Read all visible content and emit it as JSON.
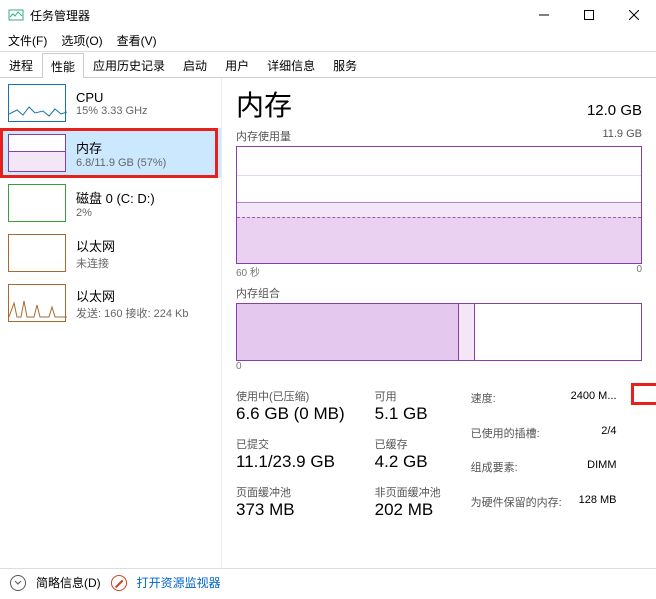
{
  "window": {
    "title": "任务管理器"
  },
  "menu": {
    "file": "文件(F)",
    "options": "选项(O)",
    "view": "查看(V)"
  },
  "tabs": [
    "进程",
    "性能",
    "应用历史记录",
    "启动",
    "用户",
    "详细信息",
    "服务"
  ],
  "active_tab": 1,
  "sidebar": [
    {
      "name": "CPU",
      "sub": "15% 3.33 GHz",
      "type": "cpu"
    },
    {
      "name": "内存",
      "sub": "6.8/11.9 GB (57%)",
      "type": "mem",
      "selected": true
    },
    {
      "name": "磁盘 0 (C: D:)",
      "sub": "2%",
      "type": "disk"
    },
    {
      "name": "以太网",
      "sub": "未连接",
      "type": "eth0"
    },
    {
      "name": "以太网",
      "sub": "发送: 160 接收: 224 Kb",
      "type": "eth1"
    }
  ],
  "detail": {
    "title": "内存",
    "total": "12.0 GB",
    "usage_label": "内存使用量",
    "usage_max": "11.9 GB",
    "axis_left": "60 秒",
    "axis_right": "0",
    "comp_label": "内存组合",
    "comp_left": "0",
    "stats": {
      "in_use_lbl": "使用中(已压缩)",
      "in_use_val": "6.6 GB (0 MB)",
      "avail_lbl": "可用",
      "avail_val": "5.1 GB",
      "commit_lbl": "已提交",
      "commit_val": "11.1/23.9 GB",
      "cached_lbl": "已缓存",
      "cached_val": "4.2 GB",
      "paged_lbl": "页面缓冲池",
      "paged_val": "373 MB",
      "nonpaged_lbl": "非页面缓冲池",
      "nonpaged_val": "202 MB"
    },
    "kv": {
      "speed_k": "速度:",
      "speed_v": "2400 M...",
      "slots_k": "已使用的插槽:",
      "slots_v": "2/4",
      "form_k": "组成要素:",
      "form_v": "DIMM",
      "hw_k": "为硬件保留的内存:",
      "hw_v": "128 MB"
    }
  },
  "footer": {
    "fewer": "简略信息(D)",
    "resmon": "打开资源监视器"
  }
}
